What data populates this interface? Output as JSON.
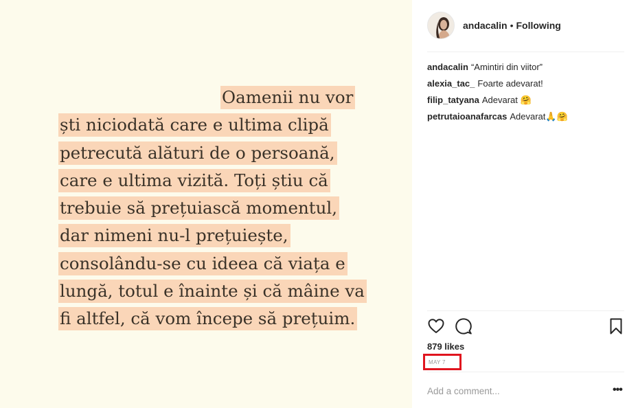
{
  "post": {
    "quote_lines": [
      "Oamenii nu vor",
      "ști niciodată care e ultima clipă",
      "petrecută alături de o persoană,",
      "care e ultima vizită. Toți știu că",
      "trebuie să prețuiască momentul,",
      "dar nimeni nu-l prețuiește,",
      "consolându-se cu ideea că viața e",
      "lungă, totul e înainte și că mâine va",
      "fi altfel, că vom începe să prețuim."
    ],
    "background_color": "#fdfbec",
    "highlight_color": "#fad6b8"
  },
  "header": {
    "username": "andacalin",
    "separator": "•",
    "follow_status": "Following"
  },
  "comments": [
    {
      "user": "andacalin",
      "text": "“Amintiri din viitor”"
    },
    {
      "user": "alexia_tac_",
      "text": "Foarte adevarat!"
    },
    {
      "user": "filip_tatyana",
      "text": "Adevarat 🤗"
    },
    {
      "user": "petrutaioanafarcas",
      "text": "Adevarat🙏🤗"
    }
  ],
  "actions": {
    "icons": [
      "heart-icon",
      "comment-icon",
      "bookmark-icon"
    ]
  },
  "likes": "879 likes",
  "date": "MAY 7",
  "highlight_box_color": "#e0141e",
  "comment_input": {
    "placeholder": "Add a comment...",
    "value": ""
  },
  "more_options": "•••"
}
